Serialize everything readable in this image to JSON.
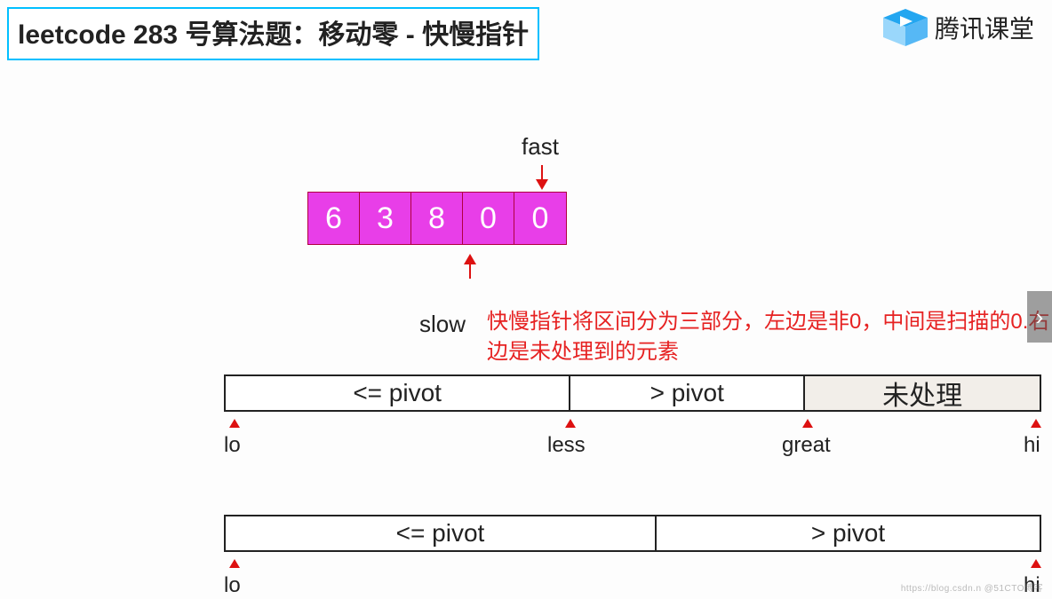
{
  "title": "leetcode 283 号算法题：移动零 - 快慢指针",
  "logo": {
    "text": "腾讯课堂"
  },
  "pointers": {
    "fast": "fast",
    "slow": "slow"
  },
  "array": [
    "6",
    "3",
    "8",
    "0",
    "0"
  ],
  "annotation": "快慢指针将区间分为三部分，左边是非0，中间是扫描的0.右边是未处理到的元素",
  "bar1": {
    "segments": [
      "<= pivot",
      "> pivot",
      "未处理"
    ],
    "labels": {
      "lo": "lo",
      "less": "less",
      "great": "great",
      "hi": "hi"
    }
  },
  "bar2": {
    "segments": [
      "<= pivot",
      "> pivot"
    ],
    "labels": {
      "lo": "lo",
      "hi": "hi"
    }
  },
  "watermark": "https://blog.csdn.n @51CTO博客"
}
